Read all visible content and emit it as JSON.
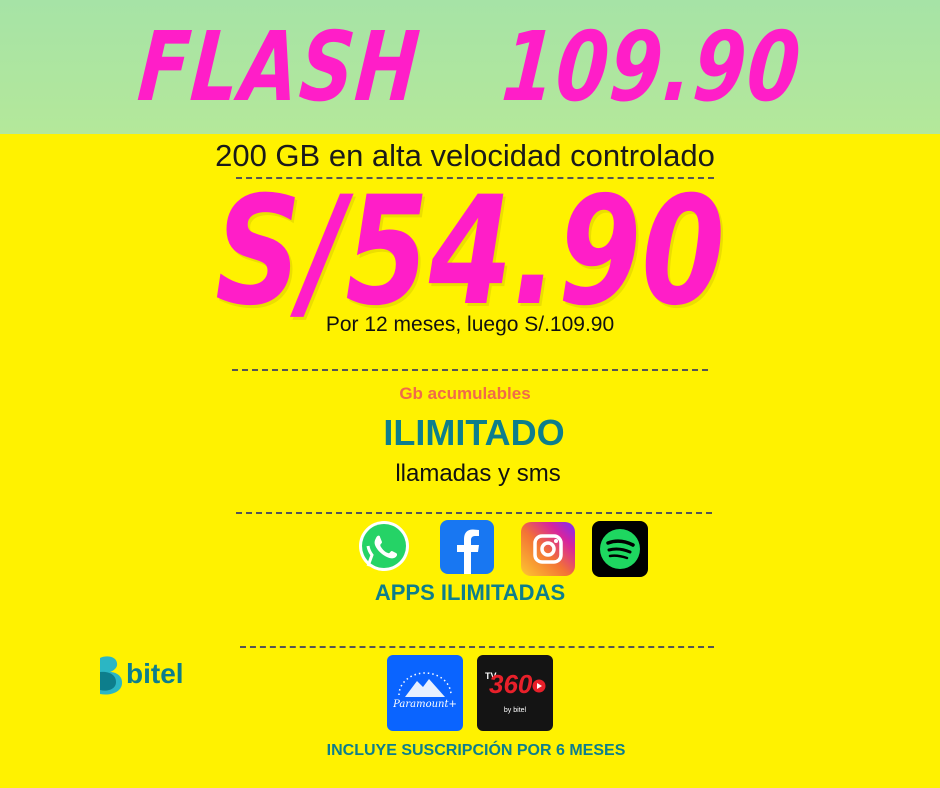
{
  "plan": {
    "title": "FLASH   109.90",
    "data_line": "200 GB en alta velocidad controlado",
    "price": "S/54.90",
    "price_note": "Por 12 meses, luego S/.109.90"
  },
  "features": {
    "gb_label": "Gb acumulables",
    "unlimited": "ILIMITADO",
    "calls": "llamadas y sms",
    "apps_label": "APPS ILIMITADAS",
    "apps": [
      {
        "icon": "whatsapp-icon"
      },
      {
        "icon": "facebook-icon"
      },
      {
        "icon": "instagram-icon"
      },
      {
        "icon": "spotify-icon"
      }
    ]
  },
  "brand": {
    "name": "bitel"
  },
  "subscriptions": {
    "paramount_text": "Paramount+",
    "tv360_text": "360",
    "tv360_small": "TV",
    "tv360_by": "by bitel",
    "footer": "INCLUYE SUSCRIPCIÓN POR 6 MESES"
  },
  "colors": {
    "background": "#fff200",
    "accent_pink": "#ff1ec8",
    "teal": "#0d7e8c",
    "top_band": "#a6e3a6"
  }
}
